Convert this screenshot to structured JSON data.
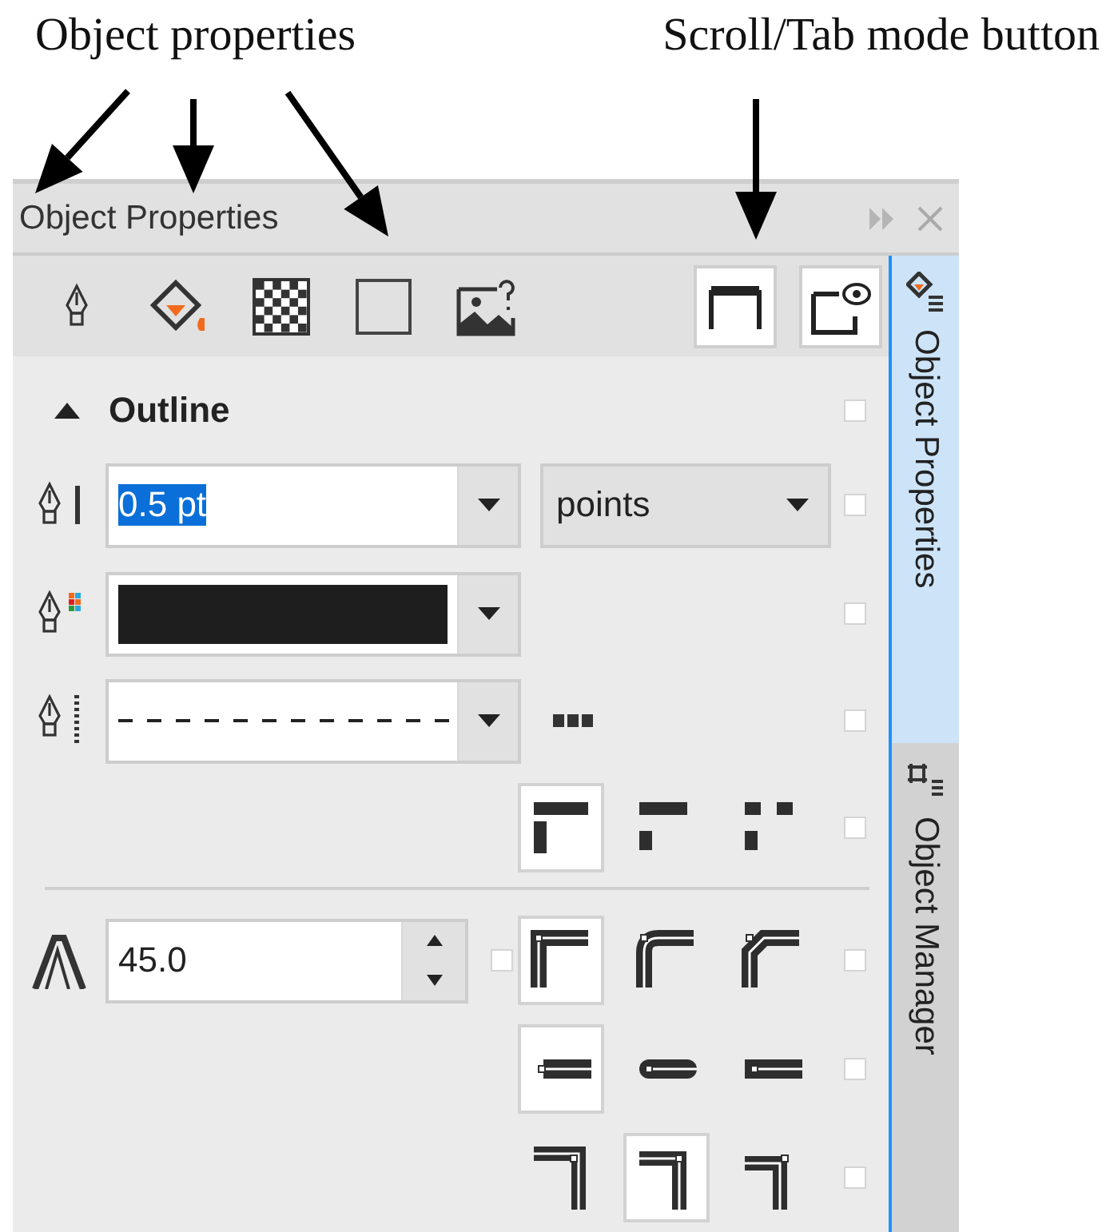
{
  "annotations": [
    {
      "text": "Object properties"
    },
    {
      "text": "Scroll/Tab mode button"
    }
  ],
  "panel": {
    "title": "Object Properties",
    "mode_buttons": [
      {
        "kind": "scroll",
        "selected": true
      },
      {
        "kind": "preview",
        "selected": true
      }
    ],
    "outline": {
      "title": "Outline",
      "expanded": true,
      "checked": false,
      "width": {
        "value": "0.5 pt",
        "text_selected": true,
        "units": "points",
        "checked": false
      },
      "color": {
        "checked": false
      },
      "style": {
        "checked": false
      },
      "miter_limit": {
        "value": "45.0",
        "checked": false
      },
      "option_rows": [
        {
          "kind": "dash",
          "checked": false,
          "options": [
            {
              "selected": true
            },
            {
              "selected": false
            },
            {
              "selected": false
            }
          ]
        },
        {
          "kind": "corner",
          "checked": false,
          "options": [
            {
              "selected": true
            },
            {
              "selected": false
            },
            {
              "selected": false
            }
          ]
        },
        {
          "kind": "cap",
          "checked": false,
          "options": [
            {
              "selected": true
            },
            {
              "selected": false
            },
            {
              "selected": false
            }
          ]
        },
        {
          "kind": "position",
          "checked": false,
          "options": [
            {
              "selected": false
            },
            {
              "selected": true
            },
            {
              "selected": false
            }
          ]
        }
      ]
    }
  },
  "side_tabs": [
    {
      "label": "Object Properties",
      "selected": true
    },
    {
      "label": "Object Manager",
      "selected": false
    }
  ]
}
